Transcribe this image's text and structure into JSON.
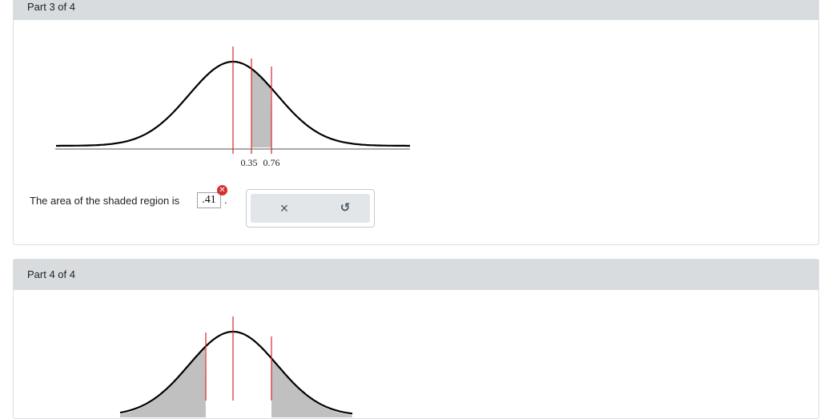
{
  "part3": {
    "header": "Part 3 of 4",
    "tick_labels": [
      "0.35",
      "0.76"
    ],
    "question_prefix": "The area of the shaded region is",
    "answer_value": ".41",
    "answer_suffix": ".",
    "answer_status": "incorrect",
    "error_icon": "x-circle-icon",
    "tools": {
      "clear_icon": "close-icon",
      "clear_glyph": "×",
      "undo_icon": "undo-icon",
      "undo_glyph": "↺"
    }
  },
  "part4": {
    "header": "Part 4 of 4"
  },
  "colors": {
    "header_bg": "#d8dcdf",
    "shade": "#c0c0c0",
    "marker_line": "#d62728",
    "error": "#d0312d"
  }
}
